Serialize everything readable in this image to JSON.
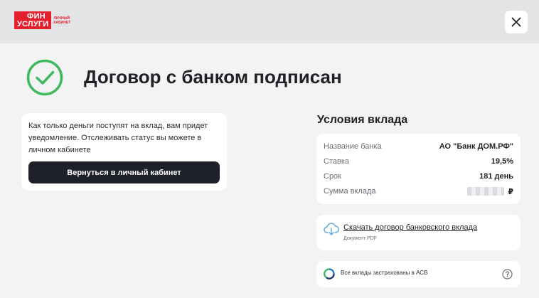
{
  "header": {
    "logo_line1": "ФИН",
    "logo_line2": "УСЛУГИ",
    "logo_sub": "личный кабинет",
    "close_icon": "close-icon"
  },
  "main": {
    "status_icon": "check-circle-icon",
    "title": "Договор с банком подписан",
    "info_text": "Как только деньги поступят на вклад, вам придет уведомление. Отслеживать статус вы можете в личном кабинете",
    "back_button": "Вернуться в личный кабинет"
  },
  "terms": {
    "title": "Условия вклада",
    "rows": [
      {
        "label": "Название банка",
        "value": "АО \"Банк ДОМ.РФ\""
      },
      {
        "label": "Ставка",
        "value": "19,5%"
      },
      {
        "label": "Срок",
        "value": "181 день"
      },
      {
        "label": "Сумма вклада",
        "value": "₽"
      }
    ]
  },
  "document": {
    "icon": "cloud-download-icon",
    "link": "Скачать договор банковского вклада",
    "sub": "Документ PDF"
  },
  "insurance": {
    "icon": "asv-logo-icon",
    "text": "Все вклады застрахованы в АСВ",
    "help_icon": "help-icon"
  },
  "colors": {
    "brand_red": "#e5202e",
    "success_green": "#3fb95e",
    "button_dark": "#1e2129",
    "page_bg": "#f3f3f4",
    "topbar_bg": "#e3e4e6"
  }
}
